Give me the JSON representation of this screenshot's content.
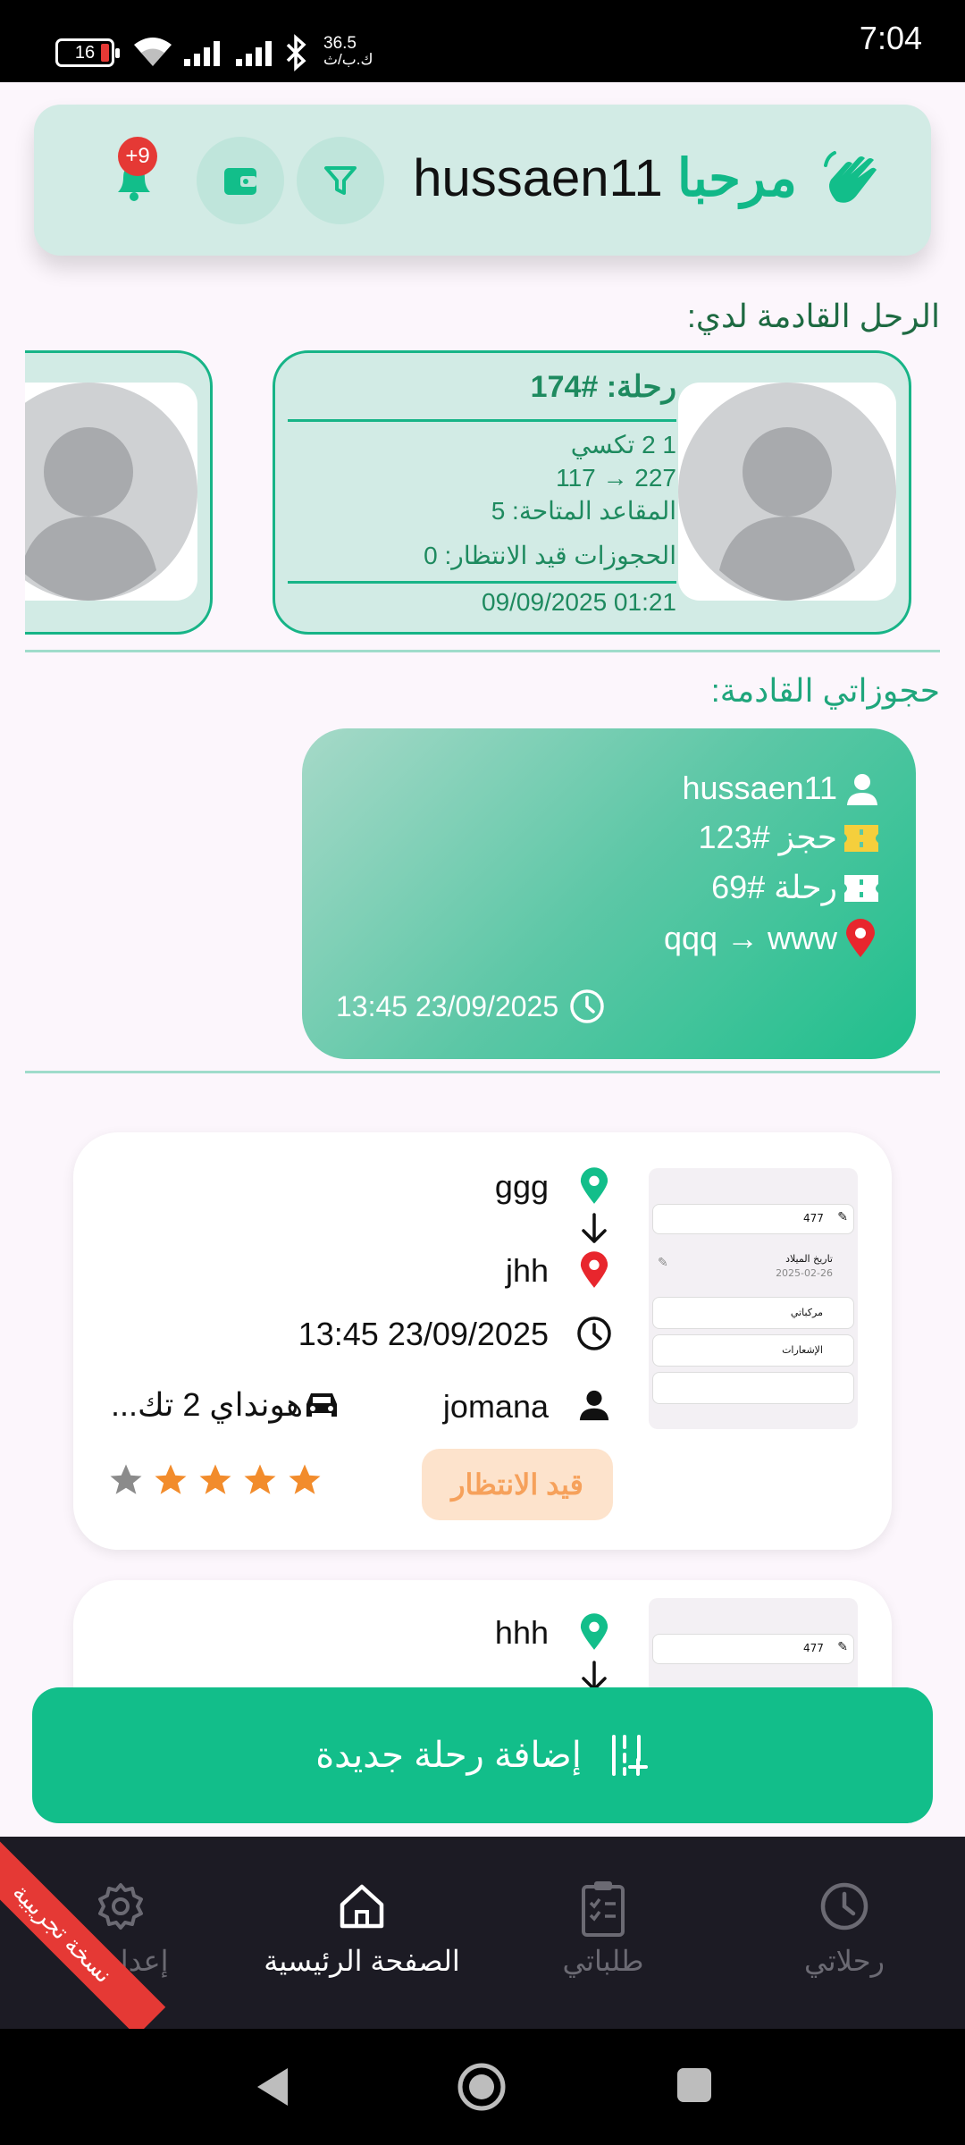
{
  "status_bar": {
    "time": "7:04",
    "battery": "16",
    "net_speed_value": "36.5",
    "net_speed_unit": "ك.ب/ث"
  },
  "header": {
    "greeting_word": "مرحبا",
    "username": "hussaen11",
    "notification_count": "+9"
  },
  "upcoming_trips": {
    "title": "الرحل القادمة لدي:",
    "trips": [
      {
        "number": "رحلة: #174",
        "vehicle": "1 2 تكسي",
        "route": "227 → 117",
        "seats": "المقاعد المتاحة: 5",
        "pending": "الحجوزات قيد الانتظار: 0",
        "datetime": "01:21 09/09/2025"
      }
    ]
  },
  "upcoming_bookings": {
    "title": "حجوزاتي القادمة:",
    "booking": {
      "user": "hussaen11",
      "booking_no": "حجز #123",
      "trip_no": "رحلة #69",
      "route": "qqq → www",
      "datetime": "13:45 23/09/2025"
    }
  },
  "requests": [
    {
      "from": "ggg",
      "to": "jhh",
      "datetime": "13:45 23/09/2025",
      "driver": "jomana",
      "car": "هونداي 2 تك...",
      "status": "قيد الانتظار",
      "rating": 4,
      "thumb": {
        "field_value": "477",
        "date_label": "تاريخ الميلاد",
        "date_value": "2025-02-26",
        "item1": "مركباتي",
        "item2": "الإشعارات"
      }
    },
    {
      "from": "hhh",
      "thumb": {
        "field_value": "477"
      }
    }
  ],
  "add_trip_button": "إضافة رحلة جديدة",
  "bottom_nav": [
    {
      "label": "رحلاتي"
    },
    {
      "label": "طلباتي"
    },
    {
      "label": "الصفحة الرئيسية"
    },
    {
      "label": "إعدادات"
    }
  ],
  "trial_ribbon": "نسخة تجريبية",
  "colors": {
    "accent": "#12be8a",
    "pending_bg": "#fde3cc",
    "pending_text": "#f6a15b",
    "star": "#f28c2c",
    "pin_green": "#12be8a",
    "pin_red": "#e8262d"
  }
}
